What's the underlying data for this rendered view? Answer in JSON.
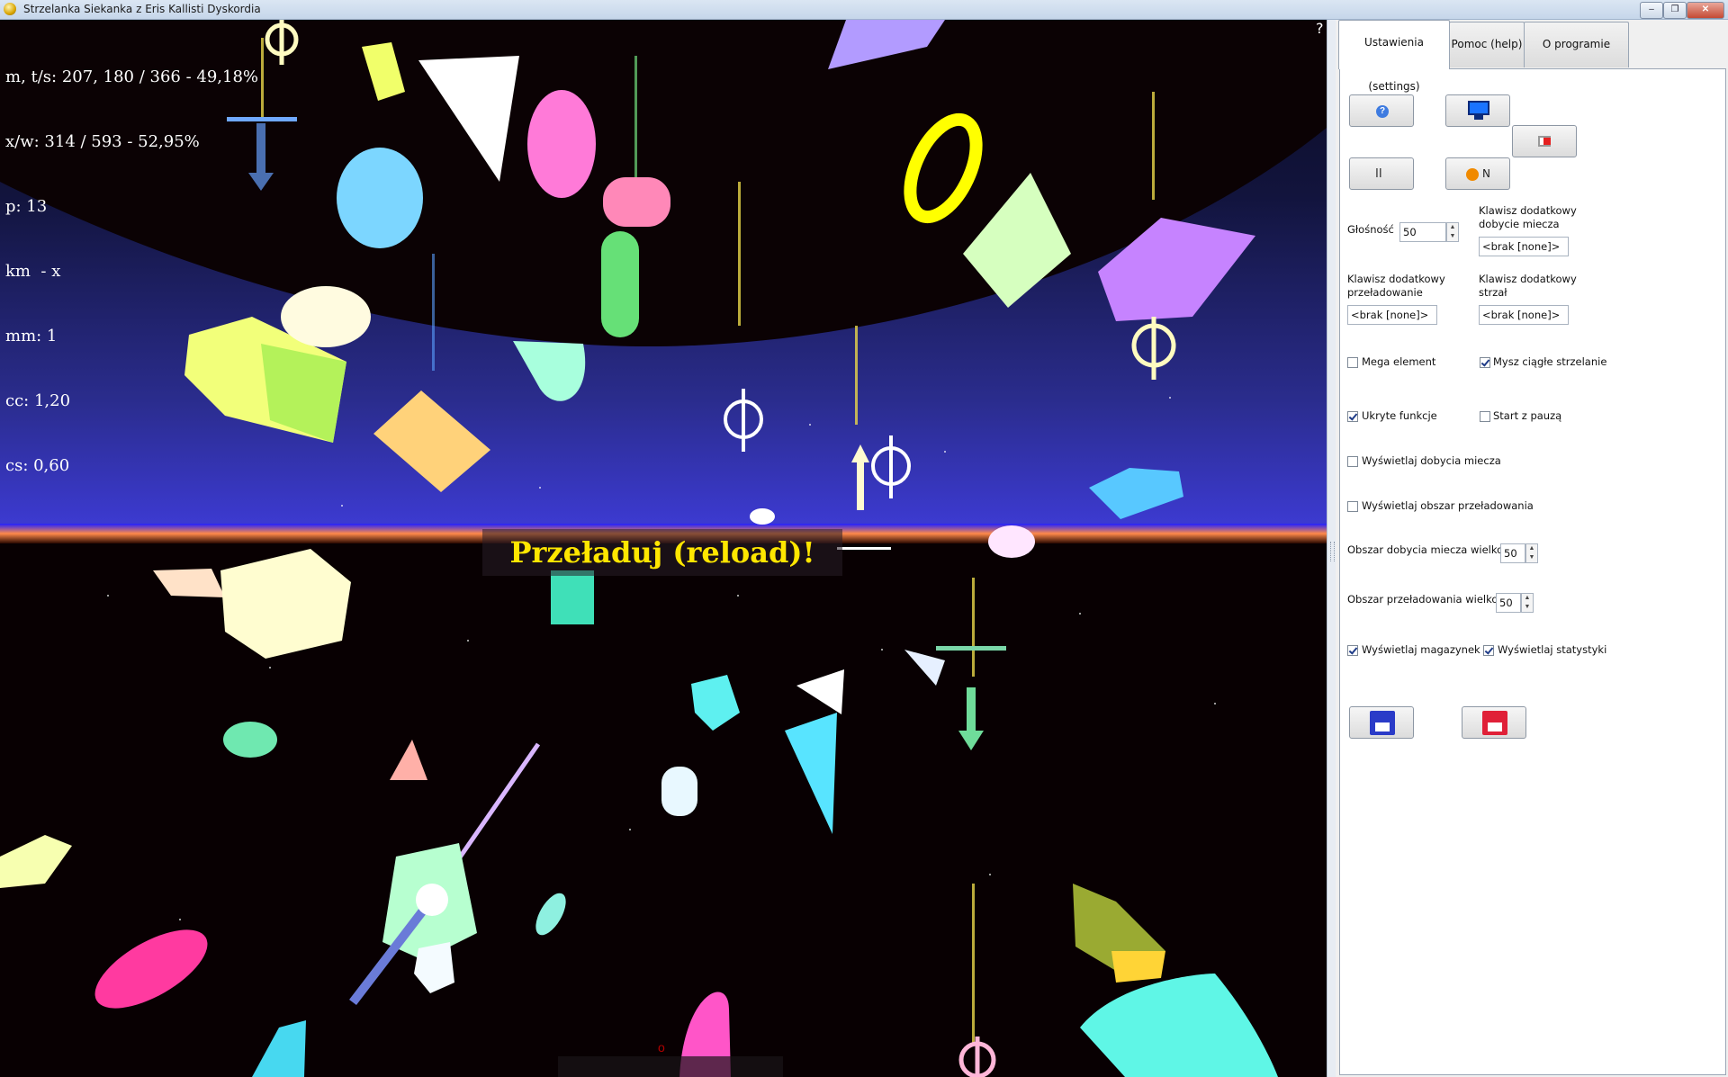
{
  "window": {
    "title": "Strzelanka Siekanka z Eris Kallisti Dyskordia",
    "buttons": {
      "minimize": "–",
      "maximize": "❐",
      "close": "✕"
    }
  },
  "hud": {
    "lines": [
      "m, t/s: 207, 180 / 366 - 49,18%",
      "x/w: 314 / 593 - 52,95%",
      "p: 13",
      "km  - x",
      "mm: 1",
      "cc: 1,20",
      "cs: 0,60"
    ],
    "reload_message": "Przeładuj (reload)!",
    "corner_question": "?",
    "bottom_mark": "o"
  },
  "tabs": [
    {
      "label": "Ustawienia (settings)",
      "active": true
    },
    {
      "label": "Pomoc (help)",
      "active": false
    },
    {
      "label": "O programie (about)",
      "active": false
    }
  ],
  "settings": {
    "buttons": {
      "help_icon": "help-icon",
      "monitor_icon": "monitor-icon",
      "exit_icon": "exit-icon",
      "pause_label": "II",
      "info_label": "N",
      "save_icon": "save-icon",
      "save_red_icon": "save-red-icon"
    },
    "volume_label": "Głośność",
    "volume_value": "50",
    "sword_key_label": "Klawisz dodatkowy dobycie miecza",
    "sword_key_value": "<brak [none]>",
    "reload_key_label": "Klawisz dodatkowy przeładowanie",
    "reload_key_value": "<brak [none]>",
    "shot_key_label": "Klawisz dodatkowy strzał",
    "shot_key_value": "<brak [none]>",
    "checkboxes": {
      "mega_element": {
        "label": "Mega element",
        "checked": false
      },
      "mouse_continuous": {
        "label": "Mysz ciągłe strzelanie",
        "checked": true
      },
      "hidden_functions": {
        "label": "Ukryte funkcje",
        "checked": true
      },
      "start_paused": {
        "label": "Start z pauzą",
        "checked": false
      },
      "show_sword_draw": {
        "label": "Wyświetlaj dobycia miecza",
        "checked": false
      },
      "show_reload_area": {
        "label": "Wyświetlaj obszar przeładowania",
        "checked": false
      },
      "show_magazine": {
        "label": "Wyświetlaj magazynek",
        "checked": true
      },
      "show_stats": {
        "label": "Wyświetlaj statystyki",
        "checked": true
      }
    },
    "sword_area_label": "Obszar dobycia miecza wielkość",
    "sword_area_value": "50",
    "reload_area_label": "Obszar przeładowania wielkość",
    "reload_area_value": "50"
  }
}
